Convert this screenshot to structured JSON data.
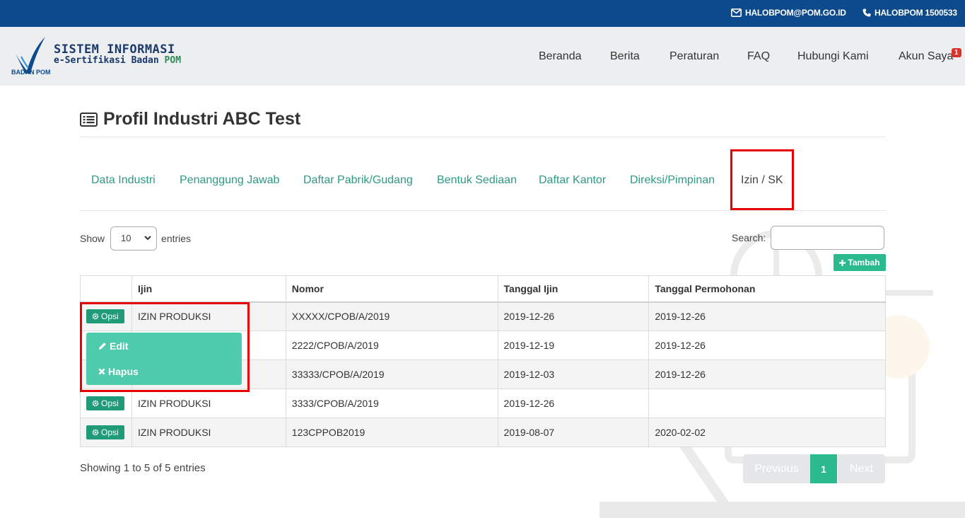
{
  "topbar": {
    "email": "HALOBPOM@POM.GO.ID",
    "phone": "HALOBPOM 1500533",
    "email_icon": "envelope-icon",
    "phone_icon": "phone-icon"
  },
  "brand": {
    "line1": "SISTEM INFORMASI",
    "line2_prefix": "e-Sertifikasi Badan ",
    "line2_highlight": "POM",
    "logo_caption": "BADAN POM"
  },
  "nav": {
    "items": [
      "Beranda",
      "Berita",
      "Peraturan",
      "FAQ",
      "Hubungi Kami",
      "Akun Saya"
    ],
    "badge": "1"
  },
  "page": {
    "title": "Profil Industri ABC Test",
    "title_icon": "list-alt-icon"
  },
  "tabs": [
    {
      "label": "Data Industri",
      "active": false
    },
    {
      "label": "Penanggung Jawab",
      "active": false
    },
    {
      "label": "Daftar Pabrik/Gudang",
      "active": false
    },
    {
      "label": "Bentuk Sediaan",
      "active": false
    },
    {
      "label": "Daftar Kantor",
      "active": false
    },
    {
      "label": "Direksi/Pimpinan",
      "active": false
    },
    {
      "label": "Izin / SK",
      "active": true
    }
  ],
  "controls": {
    "show_label": "Show",
    "page_length": "10",
    "entries_label": "entries",
    "search_label": "Search:",
    "search_value": "",
    "add_label": "Tambah"
  },
  "table": {
    "headers": [
      "",
      "Ijin",
      "Nomor",
      "Tanggal Ijin",
      "Tanggal Permohonan"
    ],
    "rows": [
      {
        "ijin": "IZIN PRODUKSI",
        "nomor": "XXXXX/CPOB/A/2019",
        "tanggal_ijin": "2019-12-26",
        "tanggal_permohonan": "2019-12-26"
      },
      {
        "ijin": "",
        "nomor": "2222/CPOB/A/2019",
        "tanggal_ijin": "2019-12-19",
        "tanggal_permohonan": "2019-12-26"
      },
      {
        "ijin": "",
        "nomor": "33333/CPOB/A/2019",
        "tanggal_ijin": "2019-12-03",
        "tanggal_permohonan": "2019-12-26"
      },
      {
        "ijin": "IZIN PRODUKSI",
        "nomor": "3333/CPOB/A/2019",
        "tanggal_ijin": "2019-12-26",
        "tanggal_permohonan": ""
      },
      {
        "ijin": "IZIN PRODUKSI",
        "nomor": "123CPPOB2019",
        "tanggal_ijin": "2019-08-07",
        "tanggal_permohonan": "2020-02-02"
      }
    ],
    "option_label": "Opsi",
    "visible_option_buttons": [
      0,
      3,
      4
    ]
  },
  "dropdown": {
    "edit_label": "Edit",
    "delete_label": "Hapus"
  },
  "footer": {
    "info": "Showing 1 to 5 of 5 entries",
    "prev": "Previous",
    "current": "1",
    "next": "Next"
  },
  "colors": {
    "topbar": "#0d4a8c",
    "accent": "#2bb98e",
    "tab_link": "#2e9a82",
    "highlight_box": "#e60000"
  }
}
